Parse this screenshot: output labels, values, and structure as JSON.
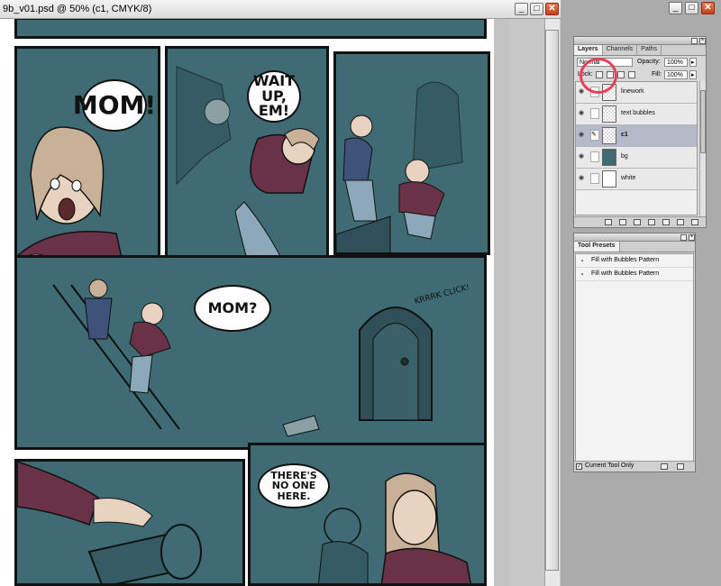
{
  "window": {
    "title": "9b_v01.psd @ 50% (c1, CMYK/8)",
    "minimize": "_",
    "maximize": "□",
    "close": "✕"
  },
  "app_window": {
    "minimize": "_",
    "maximize": "□",
    "close": "✕"
  },
  "comic": {
    "bubbles": [
      {
        "text": "MOM!",
        "size": "big"
      },
      {
        "text": "WAIT UP, EM!",
        "size": "mid"
      },
      {
        "text": "MOM?",
        "size": "mid"
      },
      {
        "text": "THERE'S NO ONE HERE.",
        "size": "small"
      }
    ],
    "sfx": "KRRRK CLICK!",
    "panel_color": "#3e6b74"
  },
  "layers_palette": {
    "tabs": [
      "Layers",
      "Channels",
      "Paths"
    ],
    "blend_mode": "Normal",
    "opacity_label": "Opacity:",
    "opacity_value": "100%",
    "lock_label": "Lock:",
    "fill_label": "Fill:",
    "fill_value": "100%",
    "layers": [
      {
        "name": "linework",
        "thumb": "checker",
        "selected": false
      },
      {
        "name": "text bubbles",
        "thumb": "checker",
        "selected": false
      },
      {
        "name": "c1",
        "thumb": "checker",
        "selected": true
      },
      {
        "name": "bg",
        "thumb": "dark",
        "selected": false
      },
      {
        "name": "white",
        "thumb": "white",
        "selected": false
      }
    ]
  },
  "tool_presets": {
    "tab": "Tool Presets",
    "items": [
      "Fill with Bubbles Pattern",
      "Fill with Bubbles Pattern"
    ],
    "current_tool_only": "Current Tool Only"
  },
  "colors": {
    "highlight_ring": "#e83f58"
  }
}
